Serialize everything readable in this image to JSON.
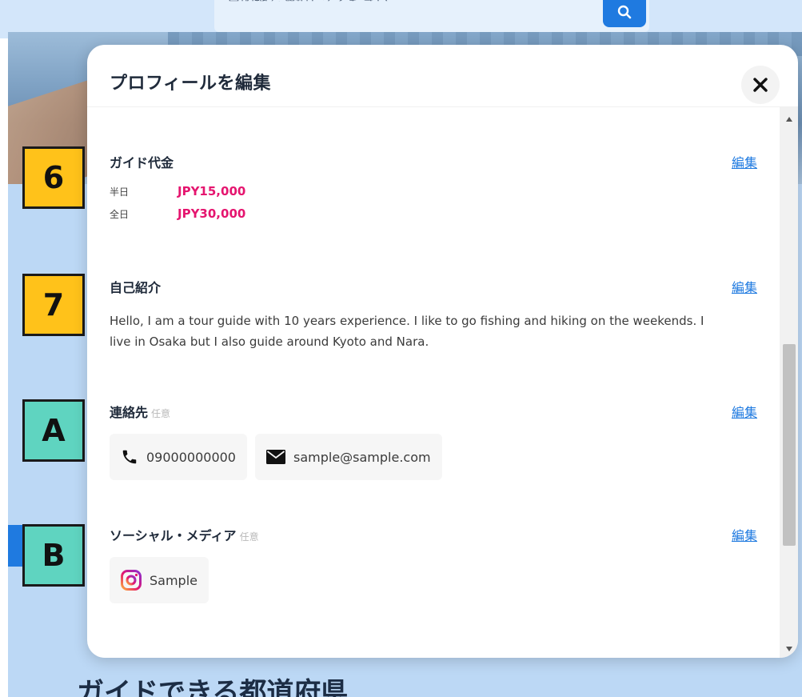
{
  "background": {
    "search_placeholder": "目的地を選択してください",
    "bottom_heading": "ガイドできる都道府県"
  },
  "markers": [
    {
      "label": "6",
      "color": "#ffc21a"
    },
    {
      "label": "7",
      "color": "#ffc21a"
    },
    {
      "label": "A",
      "color": "#5fd4c0"
    },
    {
      "label": "B",
      "color": "#5fd4c0"
    }
  ],
  "modal": {
    "title": "プロフィールを編集",
    "close_icon": "close-icon"
  },
  "guide_fee": {
    "title": "ガイド代金",
    "edit_label": "編集",
    "half_day_label": "半日",
    "half_day_value": "JPY15,000",
    "full_day_label": "全日",
    "full_day_value": "JPY30,000"
  },
  "self_intro": {
    "title": "自己紹介",
    "edit_label": "編集",
    "text": "Hello, I am a tour guide with 10 years experience. I like to go fishing and hiking on the weekends. I live in Osaka but I also guide around Kyoto and Nara."
  },
  "contact": {
    "title": "連絡先",
    "optional_label": "任意",
    "edit_label": "編集",
    "phone": "09000000000",
    "email": "sample@sample.com"
  },
  "social": {
    "title": "ソーシャル・メディア",
    "optional_label": "任意",
    "edit_label": "編集",
    "instagram": "Sample"
  },
  "colors": {
    "accent": "#1f7ae0",
    "price": "#e5156f",
    "marker_yellow": "#ffc21a",
    "marker_teal": "#5fd4c0"
  }
}
